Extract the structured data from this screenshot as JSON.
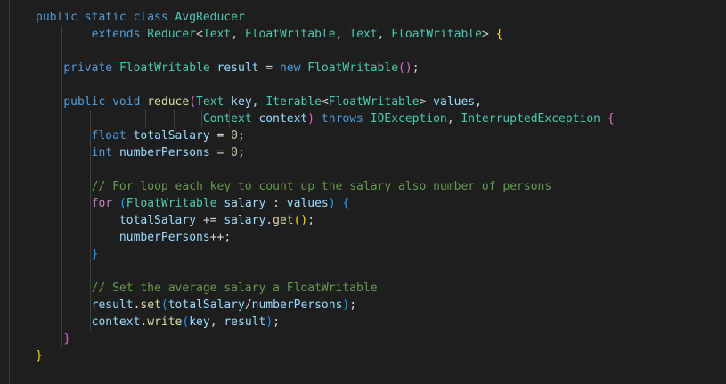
{
  "editor": {
    "language": "java",
    "lines": [
      {
        "guides": [],
        "tokens": [
          {
            "t": "public static class ",
            "c": "keyword"
          },
          {
            "t": "AvgReducer",
            "c": "type"
          }
        ]
      },
      {
        "guides": [
          1
        ],
        "tokens": [
          {
            "t": "        "
          },
          {
            "t": "extends ",
            "c": "keyword"
          },
          {
            "t": "Reducer",
            "c": "type"
          },
          {
            "t": "<",
            "c": "punct"
          },
          {
            "t": "Text",
            "c": "type"
          },
          {
            "t": ", ",
            "c": "punct"
          },
          {
            "t": "FloatWritable",
            "c": "type"
          },
          {
            "t": ", ",
            "c": "punct"
          },
          {
            "t": "Text",
            "c": "type"
          },
          {
            "t": ", ",
            "c": "punct"
          },
          {
            "t": "FloatWritable",
            "c": "type"
          },
          {
            "t": "> ",
            "c": "punct"
          },
          {
            "t": "{",
            "c": "brace-gold"
          }
        ]
      },
      {
        "guides": [
          1
        ],
        "tokens": []
      },
      {
        "guides": [
          1
        ],
        "tokens": [
          {
            "t": "    "
          },
          {
            "t": "private ",
            "c": "keyword"
          },
          {
            "t": "FloatWritable ",
            "c": "type"
          },
          {
            "t": "result",
            "c": "var"
          },
          {
            "t": " = ",
            "c": "punct"
          },
          {
            "t": "new ",
            "c": "keyword"
          },
          {
            "t": "FloatWritable",
            "c": "type"
          },
          {
            "t": "()",
            "c": "brace-pink"
          },
          {
            "t": ";",
            "c": "punct"
          }
        ]
      },
      {
        "guides": [
          1
        ],
        "tokens": []
      },
      {
        "guides": [
          1
        ],
        "tokens": [
          {
            "t": "    "
          },
          {
            "t": "public void ",
            "c": "keyword"
          },
          {
            "t": "reduce",
            "c": "func"
          },
          {
            "t": "(",
            "c": "brace-pink"
          },
          {
            "t": "Text ",
            "c": "type"
          },
          {
            "t": "key",
            "c": "var"
          },
          {
            "t": ", ",
            "c": "punct"
          },
          {
            "t": "Iterable",
            "c": "type"
          },
          {
            "t": "<",
            "c": "punct"
          },
          {
            "t": "FloatWritable",
            "c": "type"
          },
          {
            "t": "> ",
            "c": "punct"
          },
          {
            "t": "values",
            "c": "var"
          },
          {
            "t": ",",
            "c": "punct"
          }
        ]
      },
      {
        "guides": [
          1,
          2,
          3,
          4,
          5,
          6,
          7
        ],
        "tokens": [
          {
            "t": "                        "
          },
          {
            "t": "Context ",
            "c": "type"
          },
          {
            "t": "context",
            "c": "var"
          },
          {
            "t": ") ",
            "c": "brace-pink"
          },
          {
            "t": "throws ",
            "c": "keyword"
          },
          {
            "t": "IOException",
            "c": "type"
          },
          {
            "t": ", ",
            "c": "punct"
          },
          {
            "t": "InterruptedException",
            "c": "type"
          },
          {
            "t": " "
          },
          {
            "t": "{",
            "c": "brace-pink"
          }
        ]
      },
      {
        "guides": [
          1,
          2
        ],
        "tokens": [
          {
            "t": "        "
          },
          {
            "t": "float ",
            "c": "keyword"
          },
          {
            "t": "totalSalary",
            "c": "var"
          },
          {
            "t": " = ",
            "c": "punct"
          },
          {
            "t": "0",
            "c": "num"
          },
          {
            "t": ";",
            "c": "punct"
          }
        ]
      },
      {
        "guides": [
          1,
          2
        ],
        "tokens": [
          {
            "t": "        "
          },
          {
            "t": "int ",
            "c": "keyword"
          },
          {
            "t": "numberPersons",
            "c": "var"
          },
          {
            "t": " = ",
            "c": "punct"
          },
          {
            "t": "0",
            "c": "num"
          },
          {
            "t": ";",
            "c": "punct"
          }
        ]
      },
      {
        "guides": [
          1,
          2
        ],
        "tokens": []
      },
      {
        "guides": [
          1,
          2
        ],
        "tokens": [
          {
            "t": "        "
          },
          {
            "t": "// For loop each key to count up the salary also number of persons",
            "c": "comment"
          }
        ]
      },
      {
        "guides": [
          1,
          2
        ],
        "tokens": [
          {
            "t": "        "
          },
          {
            "t": "for ",
            "c": "control"
          },
          {
            "t": "(",
            "c": "brace-blue"
          },
          {
            "t": "FloatWritable ",
            "c": "type"
          },
          {
            "t": "salary",
            "c": "var"
          },
          {
            "t": " : ",
            "c": "punct"
          },
          {
            "t": "values",
            "c": "var"
          },
          {
            "t": ") ",
            "c": "brace-blue"
          },
          {
            "t": "{",
            "c": "brace-blue"
          }
        ]
      },
      {
        "guides": [
          1,
          2,
          3
        ],
        "tokens": [
          {
            "t": "            "
          },
          {
            "t": "totalSalary",
            "c": "var"
          },
          {
            "t": " += ",
            "c": "punct"
          },
          {
            "t": "salary",
            "c": "var"
          },
          {
            "t": ".",
            "c": "punct"
          },
          {
            "t": "get",
            "c": "func"
          },
          {
            "t": "()",
            "c": "brace-gold"
          },
          {
            "t": ";",
            "c": "punct"
          }
        ]
      },
      {
        "guides": [
          1,
          2,
          3
        ],
        "tokens": [
          {
            "t": "            "
          },
          {
            "t": "numberPersons",
            "c": "var"
          },
          {
            "t": "++;",
            "c": "punct"
          }
        ]
      },
      {
        "guides": [
          1,
          2
        ],
        "tokens": [
          {
            "t": "        "
          },
          {
            "t": "}",
            "c": "brace-blue"
          }
        ]
      },
      {
        "guides": [
          1,
          2
        ],
        "tokens": []
      },
      {
        "guides": [
          1,
          2
        ],
        "tokens": [
          {
            "t": "        "
          },
          {
            "t": "// Set the average salary a FloatWritable",
            "c": "comment"
          }
        ]
      },
      {
        "guides": [
          1,
          2
        ],
        "tokens": [
          {
            "t": "        "
          },
          {
            "t": "result",
            "c": "var"
          },
          {
            "t": ".",
            "c": "punct"
          },
          {
            "t": "set",
            "c": "func"
          },
          {
            "t": "(",
            "c": "brace-blue"
          },
          {
            "t": "totalSalary",
            "c": "var"
          },
          {
            "t": "/",
            "c": "punct"
          },
          {
            "t": "numberPersons",
            "c": "var"
          },
          {
            "t": ")",
            "c": "brace-blue"
          },
          {
            "t": ";",
            "c": "punct"
          }
        ]
      },
      {
        "guides": [
          1,
          2
        ],
        "tokens": [
          {
            "t": "        "
          },
          {
            "t": "context",
            "c": "var"
          },
          {
            "t": ".",
            "c": "punct"
          },
          {
            "t": "write",
            "c": "func"
          },
          {
            "t": "(",
            "c": "brace-blue"
          },
          {
            "t": "key",
            "c": "var"
          },
          {
            "t": ", ",
            "c": "punct"
          },
          {
            "t": "result",
            "c": "var"
          },
          {
            "t": ")",
            "c": "brace-blue"
          },
          {
            "t": ";",
            "c": "punct"
          }
        ]
      },
      {
        "guides": [
          1
        ],
        "tokens": [
          {
            "t": "    "
          },
          {
            "t": "}",
            "c": "brace-pink"
          }
        ]
      },
      {
        "guides": [],
        "tokens": [
          {
            "t": "}",
            "c": "brace-gold"
          }
        ]
      }
    ]
  }
}
